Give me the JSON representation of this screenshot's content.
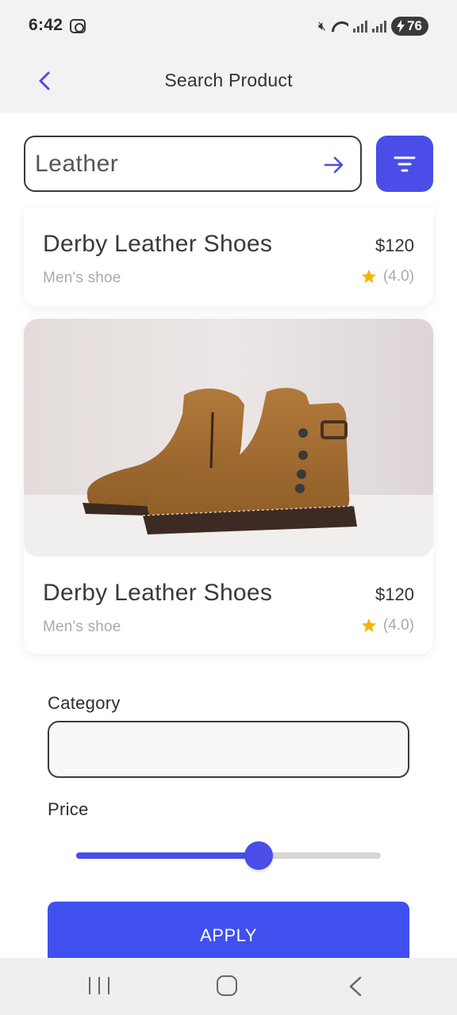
{
  "status_bar": {
    "time": "6:42",
    "battery": "76",
    "icons": [
      "screenshot-icon",
      "mute-icon",
      "wifi-icon",
      "signal-icon",
      "signal-icon",
      "battery-charging-icon"
    ]
  },
  "header": {
    "title": "Search Product",
    "back_icon": "chevron-left-icon"
  },
  "search": {
    "value": "Leather",
    "submit_icon": "arrow-right-icon",
    "filter_icon": "filter-icon"
  },
  "products": [
    {
      "name": "Derby Leather Shoes",
      "price": "$120",
      "category": "Men's shoe",
      "rating": "(4.0)"
    },
    {
      "name": "Derby Leather Shoes",
      "price": "$120",
      "category": "Men's shoe",
      "rating": "(4.0)"
    }
  ],
  "filter_panel": {
    "category_label": "Category",
    "category_value": "",
    "price_label": "Price",
    "price_slider_fraction": 0.6,
    "apply_label": "APPLY"
  },
  "colors": {
    "accent": "#4a4de7",
    "apply": "#3f50ee",
    "star": "#f5b400"
  }
}
